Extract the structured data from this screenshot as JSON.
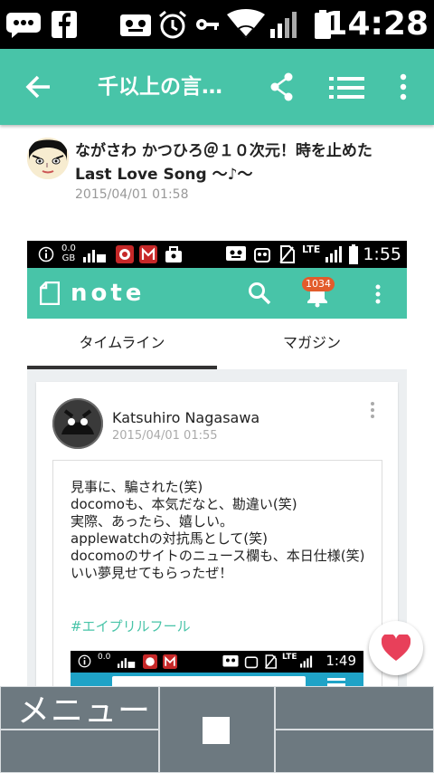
{
  "status_bar": {
    "time": "14:28",
    "icons": [
      "messenger-icon",
      "facebook-icon",
      "voicemail-icon",
      "alarm-icon",
      "key-icon",
      "wifi-icon",
      "signal-icon",
      "battery-icon"
    ]
  },
  "app_bar": {
    "title": "千以上の言…",
    "icons": [
      "back-arrow-icon",
      "share-icon",
      "list-icon",
      "more-vert-icon"
    ],
    "color": "#48c4a8"
  },
  "post": {
    "author_line1": "ながさわ かつひろ＠１０次元！時を止めた",
    "author_line2": "Last Love Song 〜♪〜",
    "date": "2015/04/01 01:58"
  },
  "embedded_screenshot": {
    "status_bar": {
      "time": "1:55",
      "net_speed_top": "0.0",
      "net_speed_unit": "GB",
      "lte_label": "LTE"
    },
    "app_bar": {
      "logo_text": "note",
      "notification_count": "1034"
    },
    "tabs": [
      {
        "label": "タイムライン",
        "active": true
      },
      {
        "label": "マガジン",
        "active": false
      }
    ],
    "card": {
      "name": "Katsuhiro Nagasawa",
      "date": "2015/04/01  01:55",
      "text": "見事に、騙された(笑)\ndocomoも、本気だなと、勘違い(笑)\n実際、あったら、嬉しい。\napplewatchの対抗馬として(笑)\ndocomoのサイトのニュース欄も、本日仕様(笑)\nいい夢見せてもらったぜ！",
      "hashtag": "#エイプリルフール",
      "nested_time": "1:49",
      "nested_net_speed": "0.0",
      "nested_lte": "LTE"
    }
  },
  "like_button": {
    "icon": "heart-icon",
    "color": "#e8405a"
  },
  "menu_bar": {
    "menu_label": "メニュー",
    "center_icon": "stop-square-icon"
  }
}
